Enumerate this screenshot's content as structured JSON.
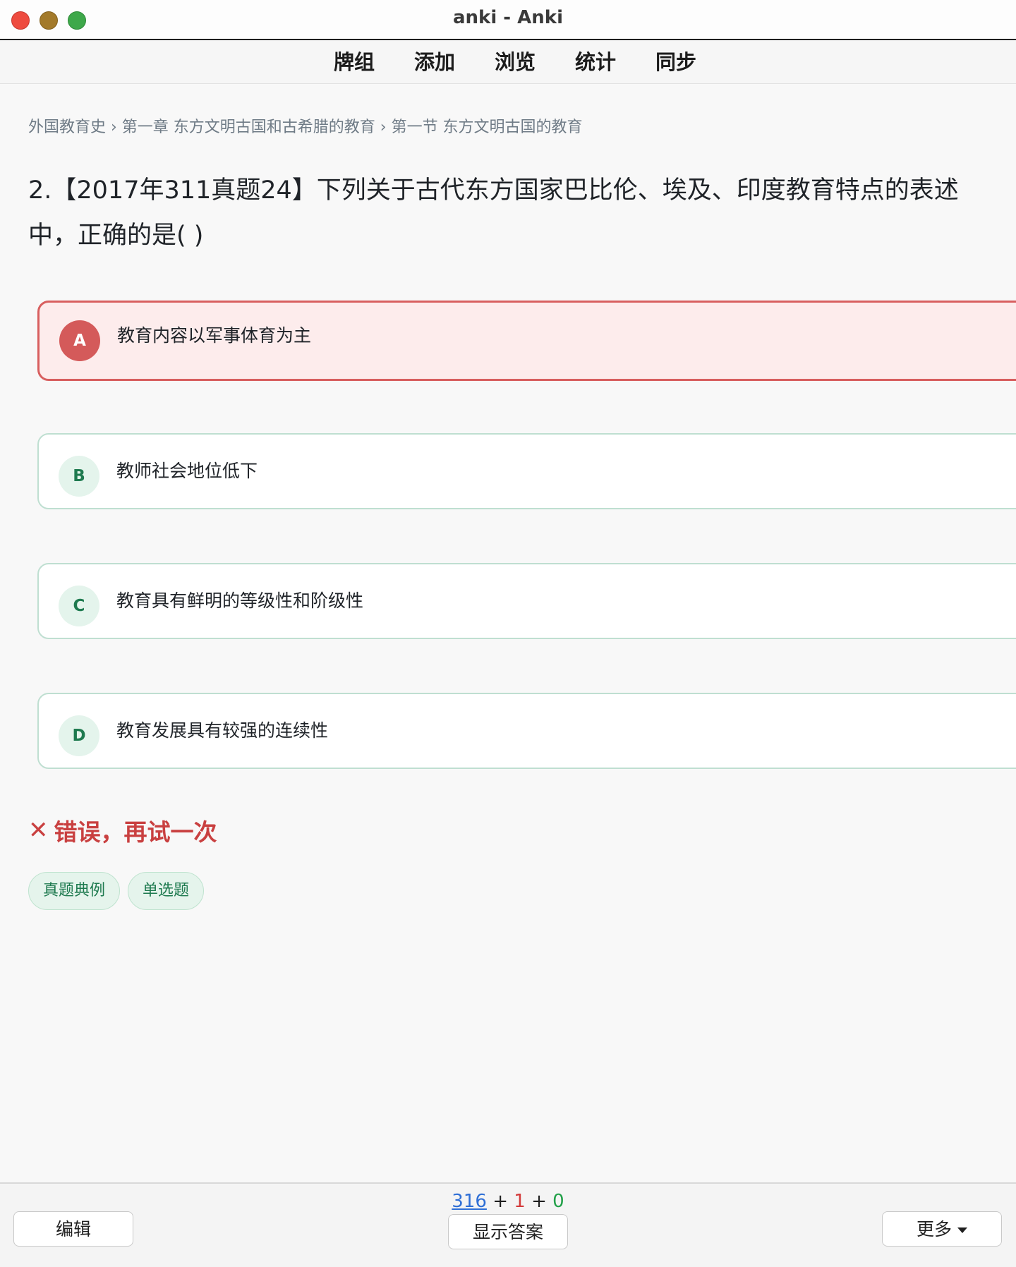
{
  "window": {
    "title": "anki - Anki"
  },
  "topnav": {
    "items": [
      "牌组",
      "添加",
      "浏览",
      "统计",
      "同步"
    ]
  },
  "breadcrumb": "外国教育史 › 第一章 东方文明古国和古希腊的教育 › 第一节 东方文明古国的教育",
  "question": "2.【2017年311真题24】下列关于古代东方国家巴比伦、埃及、印度教育特点的表述中，正确的是( )",
  "options": [
    {
      "letter": "A",
      "text": "教育内容以军事体育为主",
      "state": "wrong"
    },
    {
      "letter": "B",
      "text": "教师社会地位低下",
      "state": "normal"
    },
    {
      "letter": "C",
      "text": "教育具有鲜明的等级性和阶级性",
      "state": "normal"
    },
    {
      "letter": "D",
      "text": "教育发展具有较强的连续性",
      "state": "normal"
    }
  ],
  "feedback": {
    "icon": "✕",
    "text": "错误，再试一次"
  },
  "tags": [
    "真题典例",
    "单选题"
  ],
  "bottom": {
    "counts": {
      "new": "316",
      "learn": "1",
      "review": "0"
    },
    "edit_label": "编辑",
    "show_answer_label": "显示答案",
    "more_label": "更多"
  },
  "colors": {
    "wrong_accent": "#d45a5a",
    "option_accent": "#1e7a4f",
    "new_count": "#2f6fd6",
    "learn_count": "#d33a3a",
    "review_count": "#21a048"
  }
}
